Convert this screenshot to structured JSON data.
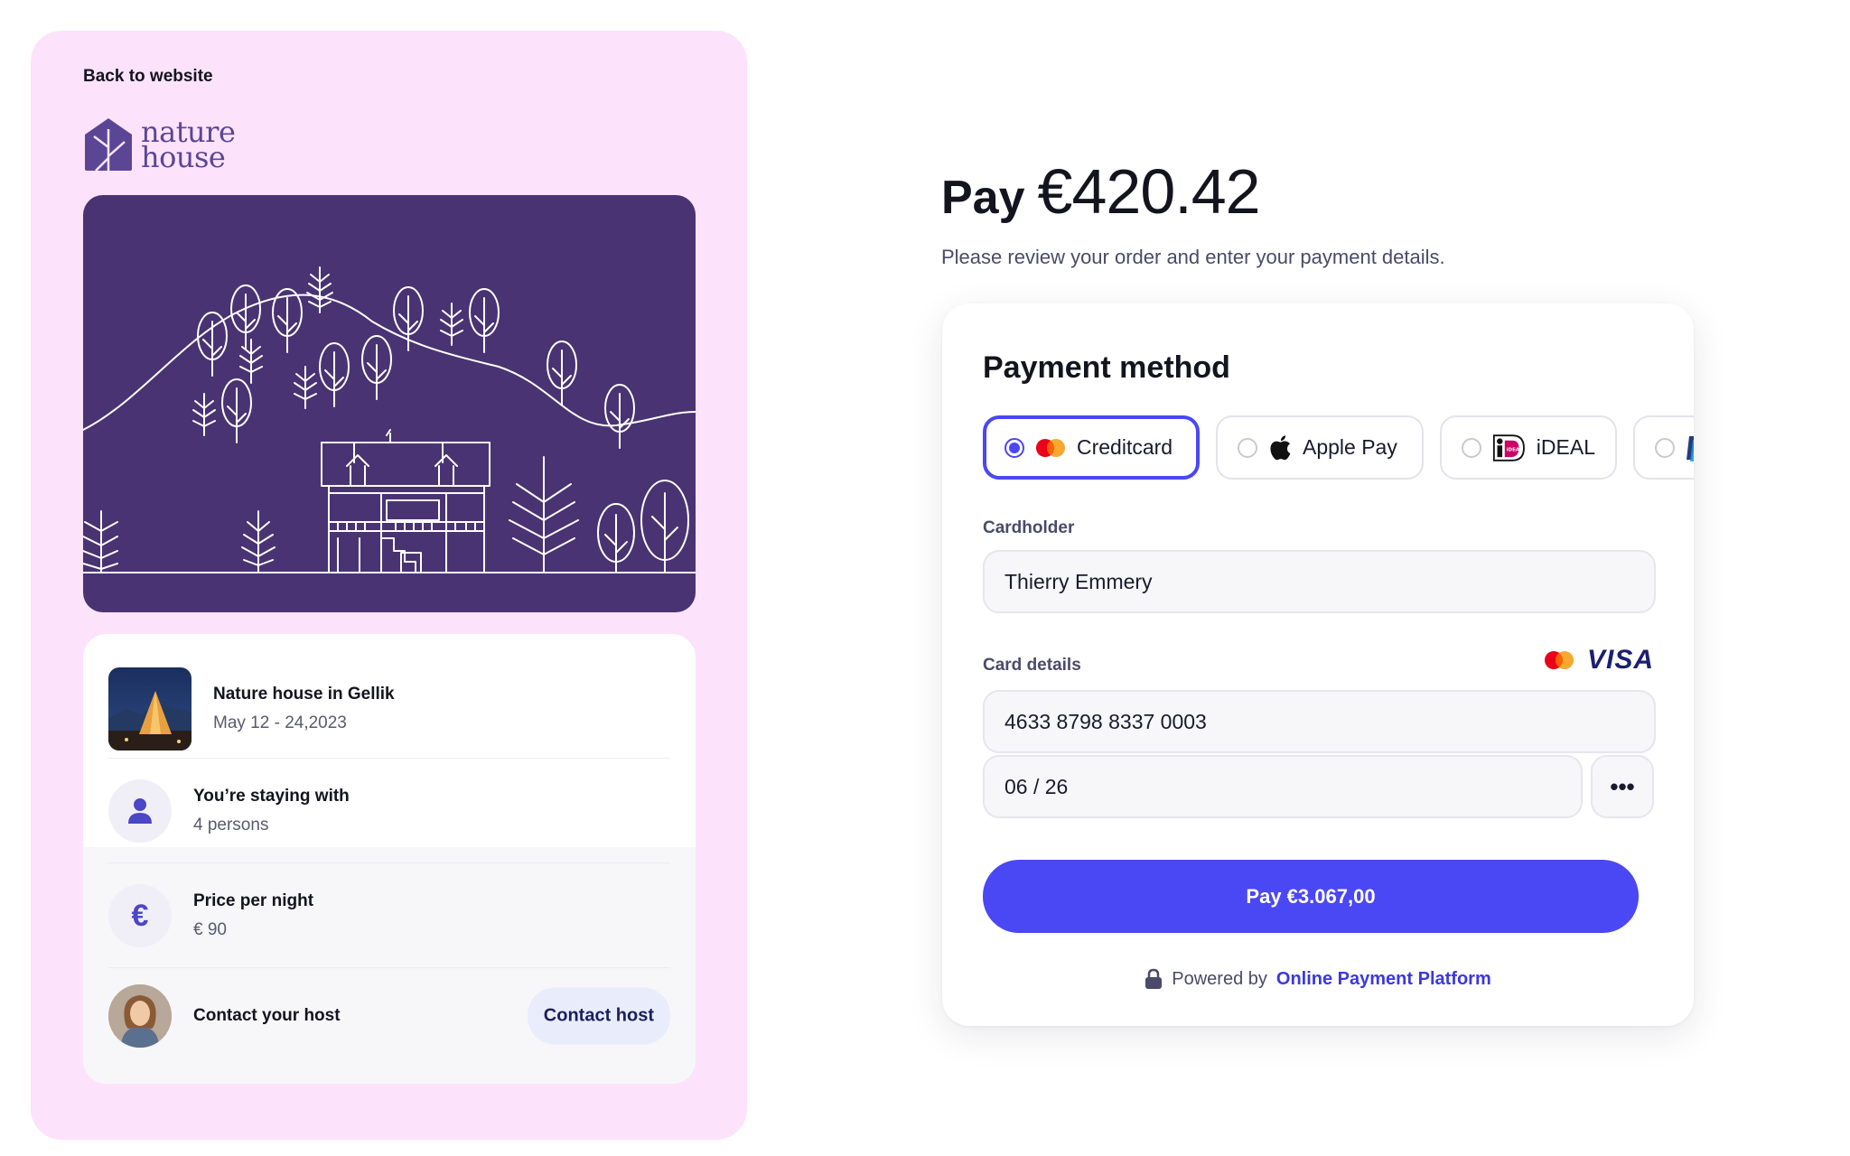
{
  "left": {
    "back_link": "Back to website",
    "logo": {
      "line1": "nature",
      "line2": "house"
    },
    "booking": {
      "title": "Nature house in Gellik",
      "dates": "May 12 - 24,2023"
    },
    "staying": {
      "title": "You’re staying with",
      "value": "4 persons"
    },
    "price": {
      "title": "Price per night",
      "value": "€ 90",
      "icon_symbol": "€"
    },
    "host": {
      "title": "Contact your host",
      "button": "Contact host"
    }
  },
  "checkout": {
    "pay_word": "Pay",
    "amount": "€420.42",
    "subtitle": "Please review your order and enter your payment details.",
    "payment_method_title": "Payment method",
    "methods": [
      {
        "label": "Creditcard",
        "selected": true,
        "icon": "mastercard-icon"
      },
      {
        "label": "Apple Pay",
        "selected": false,
        "icon": "apple-icon"
      },
      {
        "label": "iDEAL",
        "selected": false,
        "icon": "ideal-icon"
      },
      {
        "label": "",
        "selected": false,
        "icon": "paypal-icon"
      }
    ],
    "cardholder_label": "Cardholder",
    "cardholder_value": "Thierry Emmery",
    "card_details_label": "Card details",
    "card_brand_visa": "VISA",
    "card_number": "4633 8798 8337 0003",
    "expiry": "06 / 26",
    "cvc_masked": "•••",
    "pay_button": "Pay €3.067,00",
    "powered_by": "Powered by",
    "powered_link": "Online Payment Platform"
  },
  "colors": {
    "accent": "#4a47f5",
    "panel_bg": "#fce3fb",
    "hero_bg": "#4a3372",
    "brand_purple": "#5b4696"
  }
}
